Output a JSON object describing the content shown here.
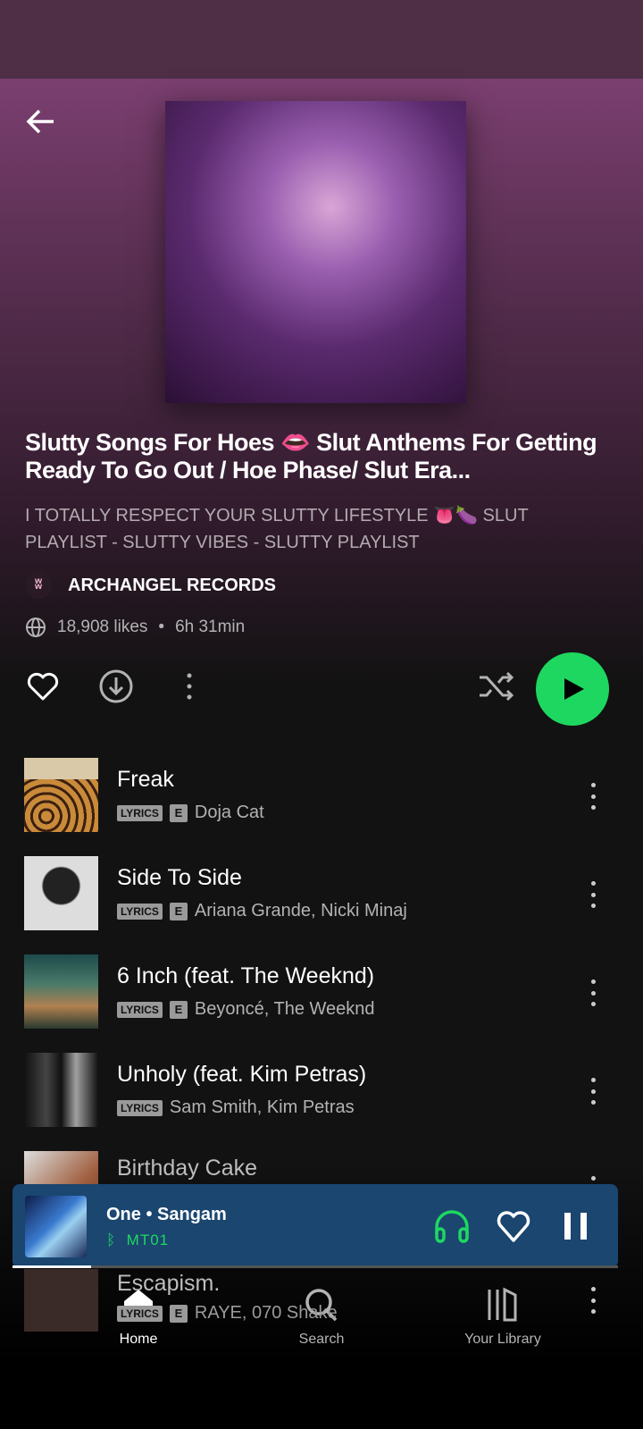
{
  "playlist": {
    "title": "Slutty Songs For Hoes 👄 Slut Anthems For Getting Ready To Go Out / Hoe Phase/ Slut Era...",
    "description": "I TOTALLY RESPECT YOUR SLUTTY LIFESTYLE 👅🍆 SLUT PLAYLIST - SLUTTY VIBES - SLUTTY PLAYLIST",
    "owner": "ARCHANGEL RECORDS",
    "likes": "18,908 likes",
    "duration": "6h 31min",
    "separator": "•"
  },
  "badges": {
    "lyrics": "LYRICS",
    "explicit": "E"
  },
  "tracks": [
    {
      "title": "Freak",
      "artists": "Doja Cat",
      "lyrics": true,
      "explicit": true
    },
    {
      "title": "Side To Side",
      "artists": "Ariana Grande, Nicki Minaj",
      "lyrics": true,
      "explicit": true
    },
    {
      "title": "6 Inch (feat. The Weeknd)",
      "artists": "Beyoncé, The Weeknd",
      "lyrics": true,
      "explicit": true
    },
    {
      "title": "Unholy (feat. Kim Petras)",
      "artists": "Sam Smith, Kim Petras",
      "lyrics": true,
      "explicit": false
    },
    {
      "title": "Birthday Cake",
      "artists": "",
      "lyrics": false,
      "explicit": false
    },
    {
      "title": "Escapism.",
      "artists": "RAYE, 070 Shake",
      "lyrics": true,
      "explicit": true
    }
  ],
  "now_playing": {
    "song": "One • Sangam",
    "device": "MT01",
    "progress": 0.13
  },
  "nav": [
    {
      "label": "Home",
      "active": true
    },
    {
      "label": "Search"
    },
    {
      "label": "Your Library"
    }
  ],
  "colors": {
    "accent": "#1ed760",
    "mini_player": "#1a4670",
    "header": "#7b3f70"
  }
}
